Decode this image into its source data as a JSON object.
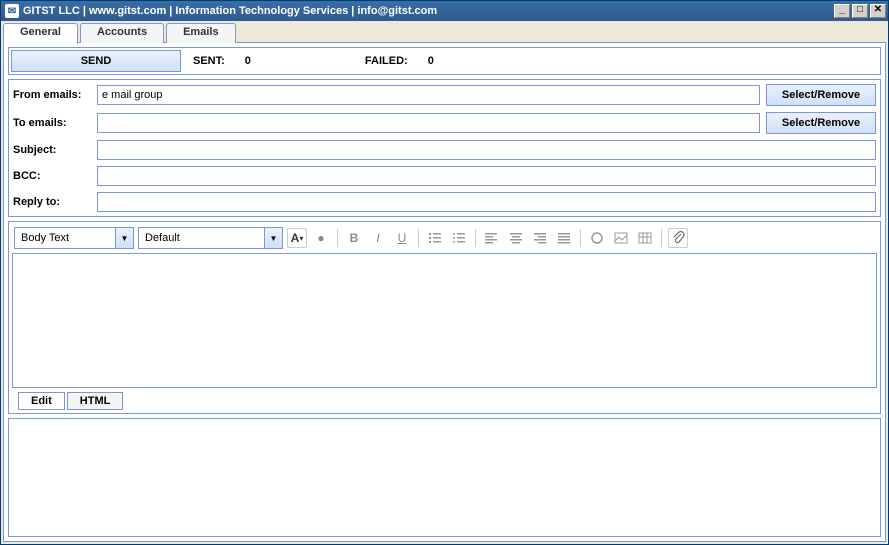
{
  "title": "GITST LLC | www.gitst.com | Information Technology Services | info@gitst.com",
  "tabs": {
    "general": "General",
    "accounts": "Accounts",
    "emails": "Emails"
  },
  "send": "SEND",
  "stats": {
    "sent_label": "SENT:",
    "sent_value": "0",
    "failed_label": "FAILED:",
    "failed_value": "0"
  },
  "fields": {
    "from_label": "From emails:",
    "from_value": "e mail group",
    "to_label": "To emails:",
    "to_value": "",
    "subject_label": "Subject:",
    "subject_value": "",
    "bcc_label": "BCC:",
    "bcc_value": "",
    "reply_label": "Reply to:",
    "reply_value": "",
    "select_remove": "Select/Remove"
  },
  "editor": {
    "style": "Body Text",
    "font": "Default",
    "tab_edit": "Edit",
    "tab_html": "HTML"
  }
}
